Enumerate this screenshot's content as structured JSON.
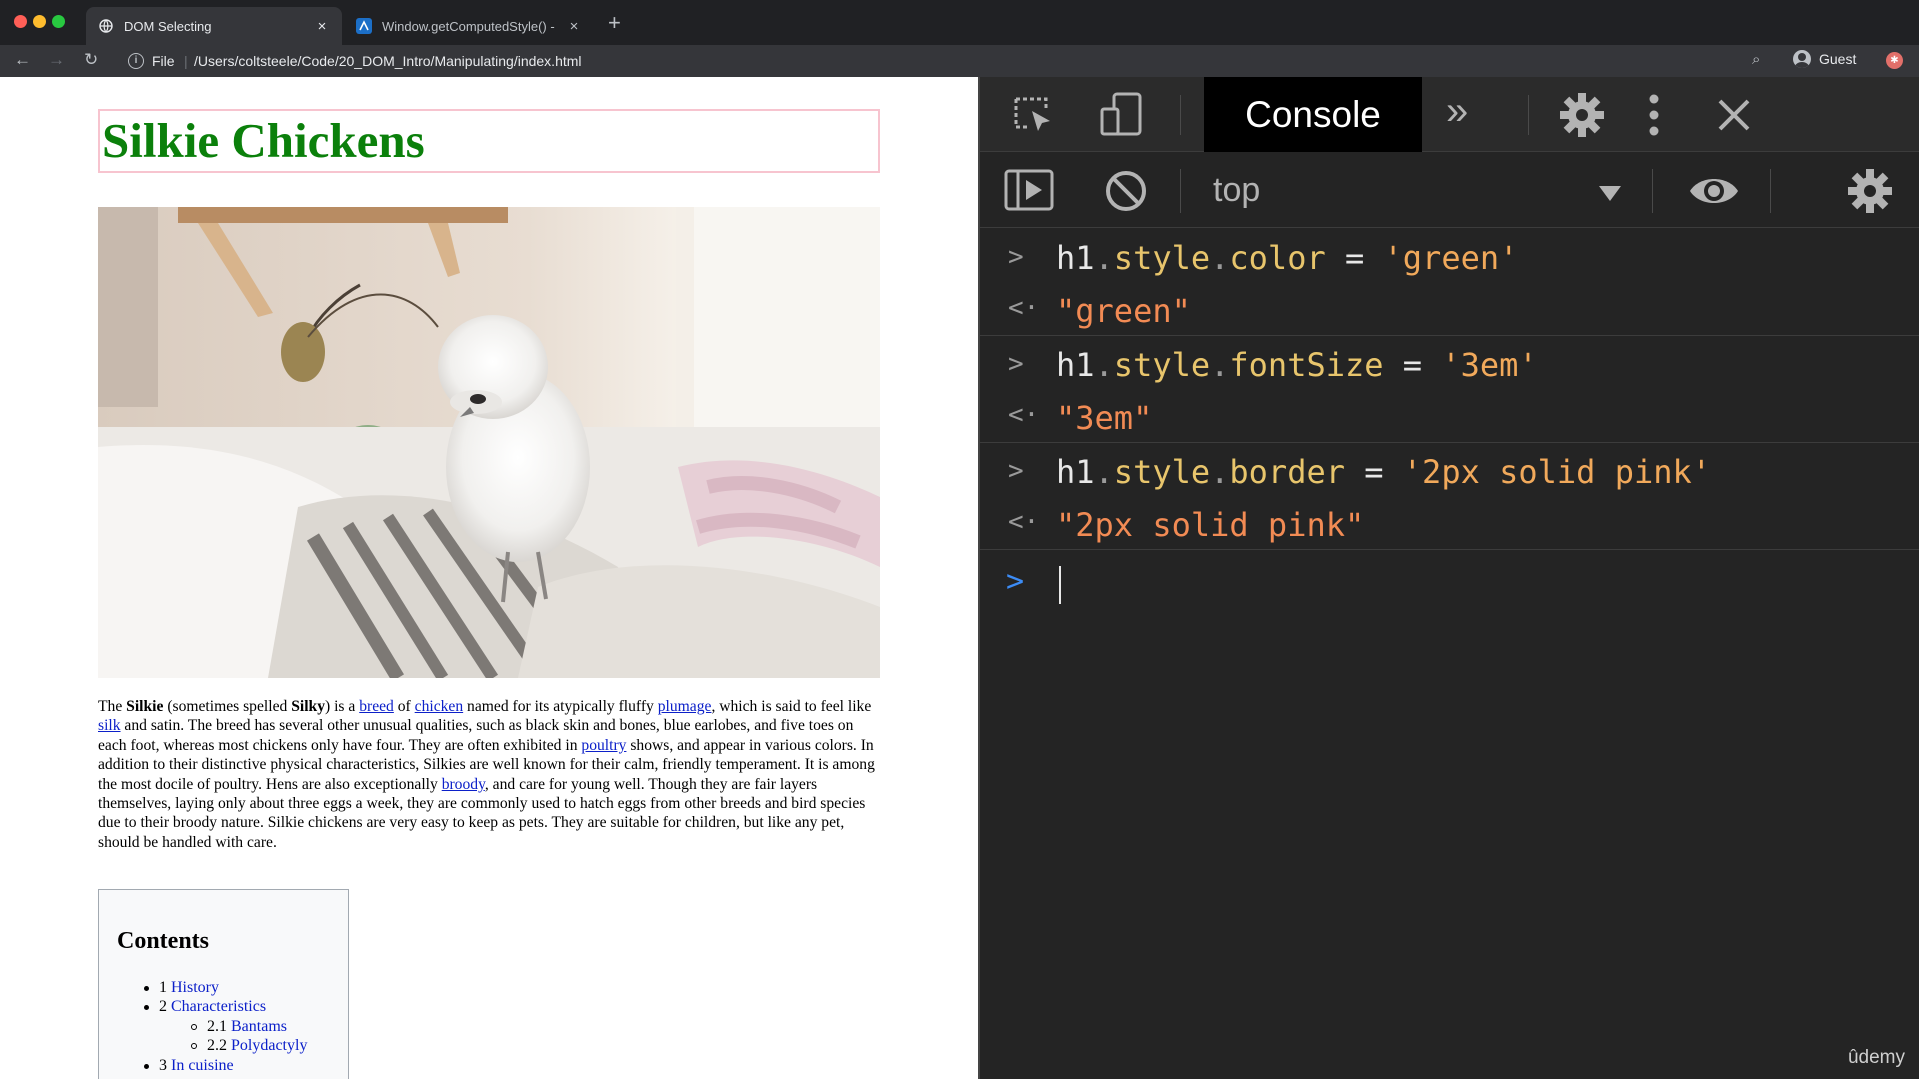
{
  "browser": {
    "tabs": [
      {
        "title": "DOM Selecting",
        "active": true
      },
      {
        "title": "Window.getComputedStyle() -",
        "active": false
      }
    ],
    "address": {
      "scheme_label": "File",
      "separator": "|",
      "url": "/Users/coltsteele/Code/20_DOM_Intro/Manipulating/index.html"
    },
    "profile_label": "Guest"
  },
  "page": {
    "heading": "Silkie Chickens",
    "heading_color": "#0b800b",
    "heading_border_color": "#f7c4cf",
    "article": {
      "p1": "The ",
      "b1": "Silkie",
      "p2": " (sometimes spelled ",
      "b2": "Silky",
      "p3": ") is a ",
      "l1": "breed",
      "p4": " of ",
      "l2": "chicken",
      "p5": " named for its atypically fluffy ",
      "l3": "plumage",
      "p6": ", which is said to feel like ",
      "l4": "silk",
      "p7": " and satin. The breed has several other unusual qualities, such as black skin and bones, blue earlobes, and five toes on each foot, whereas most chickens only have four. They are often exhibited in ",
      "l5": "poultry",
      "p8": " shows, and appear in various colors. In addition to their distinctive physical characteristics, Silkies are well known for their calm, friendly temperament. It is among the most docile of poultry. Hens are also exceptionally ",
      "l6": "broody",
      "p9": ", and care for young well. Though they are fair layers themselves, laying only about three eggs a week, they are commonly used to hatch eggs from other breeds and bird species due to their broody nature. Silkie chickens are very easy to keep as pets. They are suitable for children, but like any pet, should be handled with care."
    },
    "toc": {
      "title": "Contents",
      "items": [
        {
          "num": "1",
          "label": "History"
        },
        {
          "num": "2",
          "label": "Characteristics"
        },
        {
          "num": "2.1",
          "label": "Bantams"
        },
        {
          "num": "2.2",
          "label": "Polydactyly"
        },
        {
          "num": "3",
          "label": "In cuisine"
        }
      ]
    }
  },
  "devtools": {
    "active_tab": "Console",
    "context": "top",
    "messages": [
      {
        "input": {
          "obj": "h1",
          "d1": ".",
          "prop1": "style",
          "d2": ".",
          "prop2": "color",
          "op": " = ",
          "str": "'green'"
        },
        "output": "\"green\""
      },
      {
        "input": {
          "obj": "h1",
          "d1": ".",
          "prop1": "style",
          "d2": ".",
          "prop2": "fontSize",
          "op": " = ",
          "str": "'3em'"
        },
        "output": "\"3em\""
      },
      {
        "input": {
          "obj": "h1",
          "d1": ".",
          "prop1": "style",
          "d2": ".",
          "prop2": "border",
          "op": " = ",
          "str": "'2px solid pink'"
        },
        "output": "\"2px solid pink\""
      }
    ],
    "input_chevron": ">",
    "output_chevron": "<·",
    "prompt_chevron": ">"
  },
  "watermark": "ûdemy",
  "icons": {
    "close": "×",
    "new_tab": "+",
    "back": "←",
    "forward": "→",
    "reload": "↻",
    "zoom": "⌕",
    "overflow": "»"
  }
}
